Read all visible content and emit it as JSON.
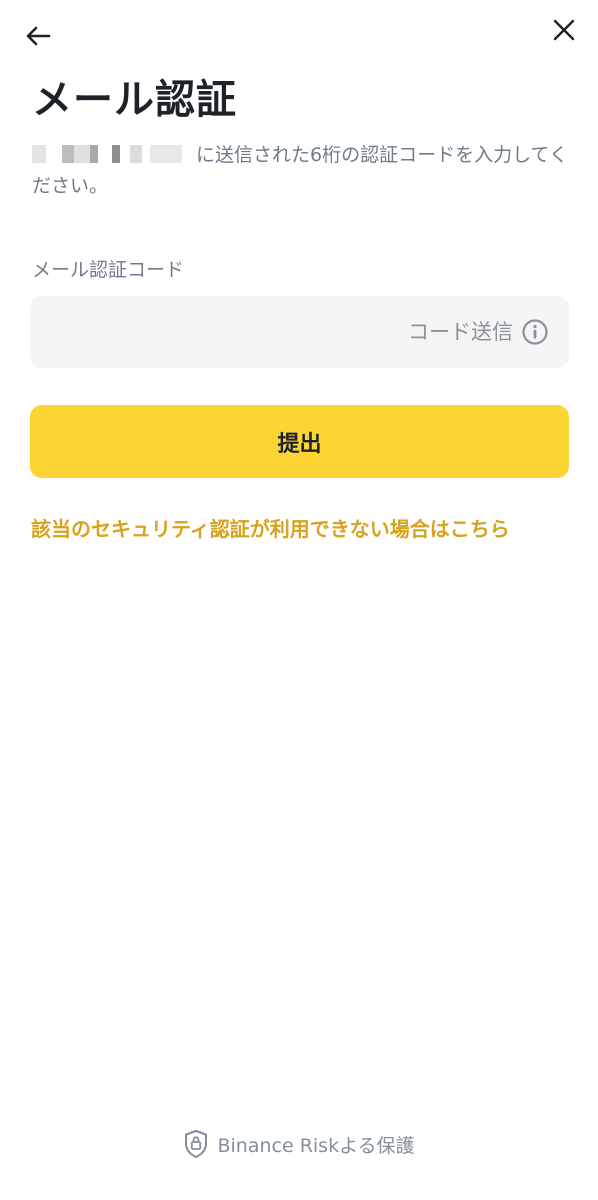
{
  "nav": {
    "back_icon": "arrow-left-icon",
    "close_icon": "close-icon"
  },
  "page": {
    "title": "メール認証",
    "description": "に送信された6桁の認証コードを入力してください。"
  },
  "form": {
    "field_label": "メール認証コード",
    "code_value": "",
    "send_code_label": "コード送信",
    "info_icon": "info-circle-icon",
    "submit_label": "提出"
  },
  "links": {
    "security_unavailable": "該当のセキュリティ認証が利用できない場合はこちら"
  },
  "footer": {
    "shield_icon": "shield-lock-icon",
    "text": "Binance Riskよる保護"
  },
  "colors": {
    "accent": "#FCD535",
    "link": "#D8A21F",
    "muted_text": "#707A8A",
    "input_background": "#F5F5F5"
  }
}
